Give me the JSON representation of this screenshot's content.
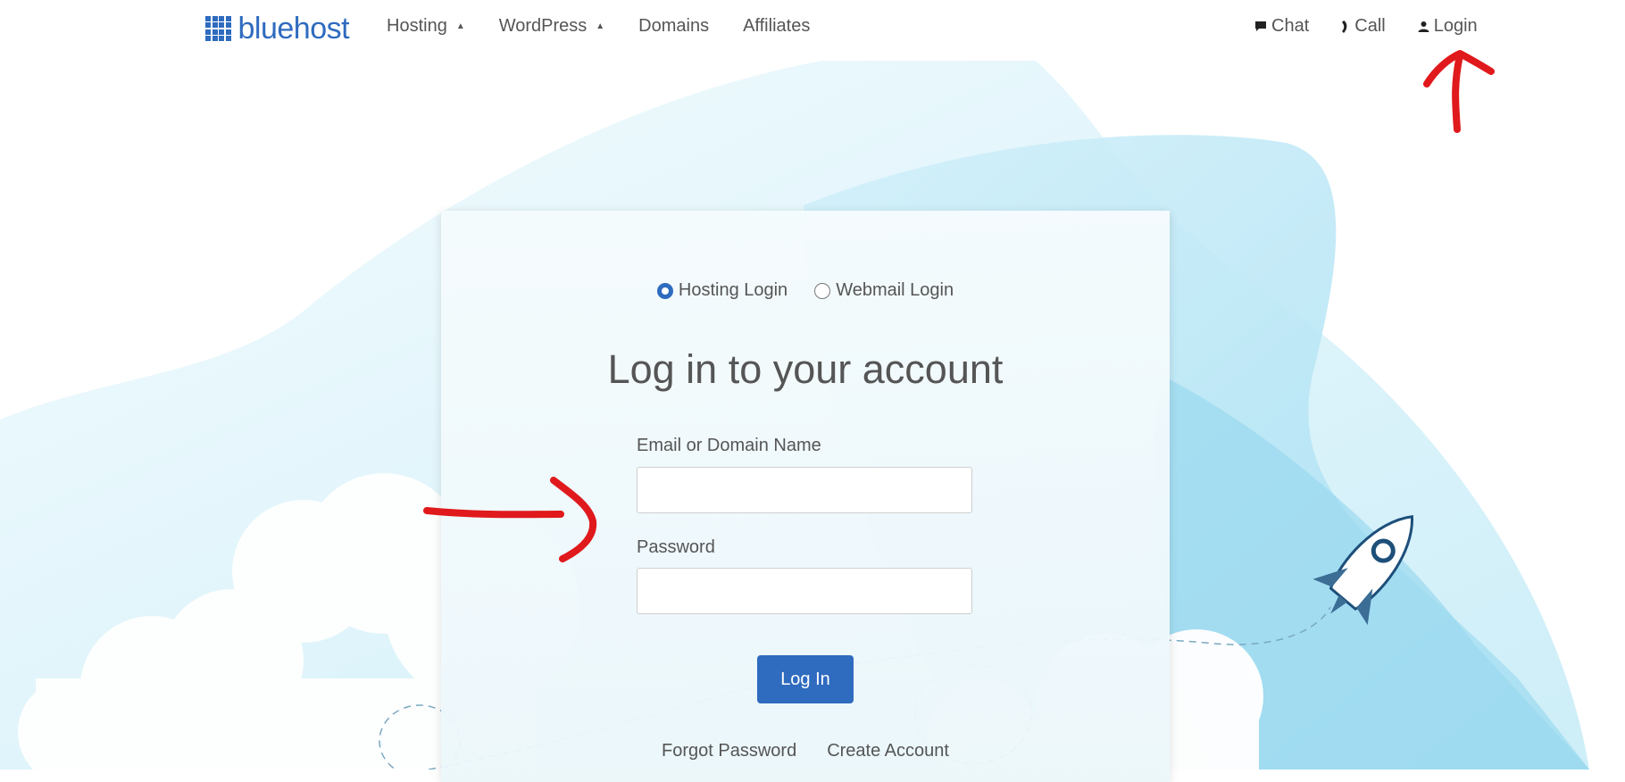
{
  "brand": {
    "name": "bluehost",
    "color": "#2f6bbf"
  },
  "nav": {
    "items": [
      {
        "label": "Hosting",
        "has_dropdown": true
      },
      {
        "label": "WordPress",
        "has_dropdown": true
      },
      {
        "label": "Domains",
        "has_dropdown": false
      },
      {
        "label": "Affiliates",
        "has_dropdown": false
      }
    ],
    "right": {
      "chat": {
        "label": "Chat",
        "icon": "chat-bubble-icon"
      },
      "call": {
        "label": "Call",
        "icon": "phone-icon"
      },
      "login": {
        "label": "Login",
        "icon": "user-icon"
      }
    }
  },
  "login_card": {
    "options": [
      {
        "label": "Hosting Login",
        "selected": true
      },
      {
        "label": "Webmail Login",
        "selected": false
      }
    ],
    "title": "Log in to your account",
    "email_label": "Email or Domain Name",
    "email_value": "",
    "password_label": "Password",
    "password_value": "",
    "submit_label": "Log In",
    "forgot_label": "Forgot Password",
    "create_label": "Create Account"
  },
  "colors": {
    "accent": "#2f6bbf",
    "annotation": "#e0191c",
    "sky_light": "#dff3fa",
    "sky_mid": "#b9e6f5",
    "sky_dark": "#8fd4ee"
  }
}
